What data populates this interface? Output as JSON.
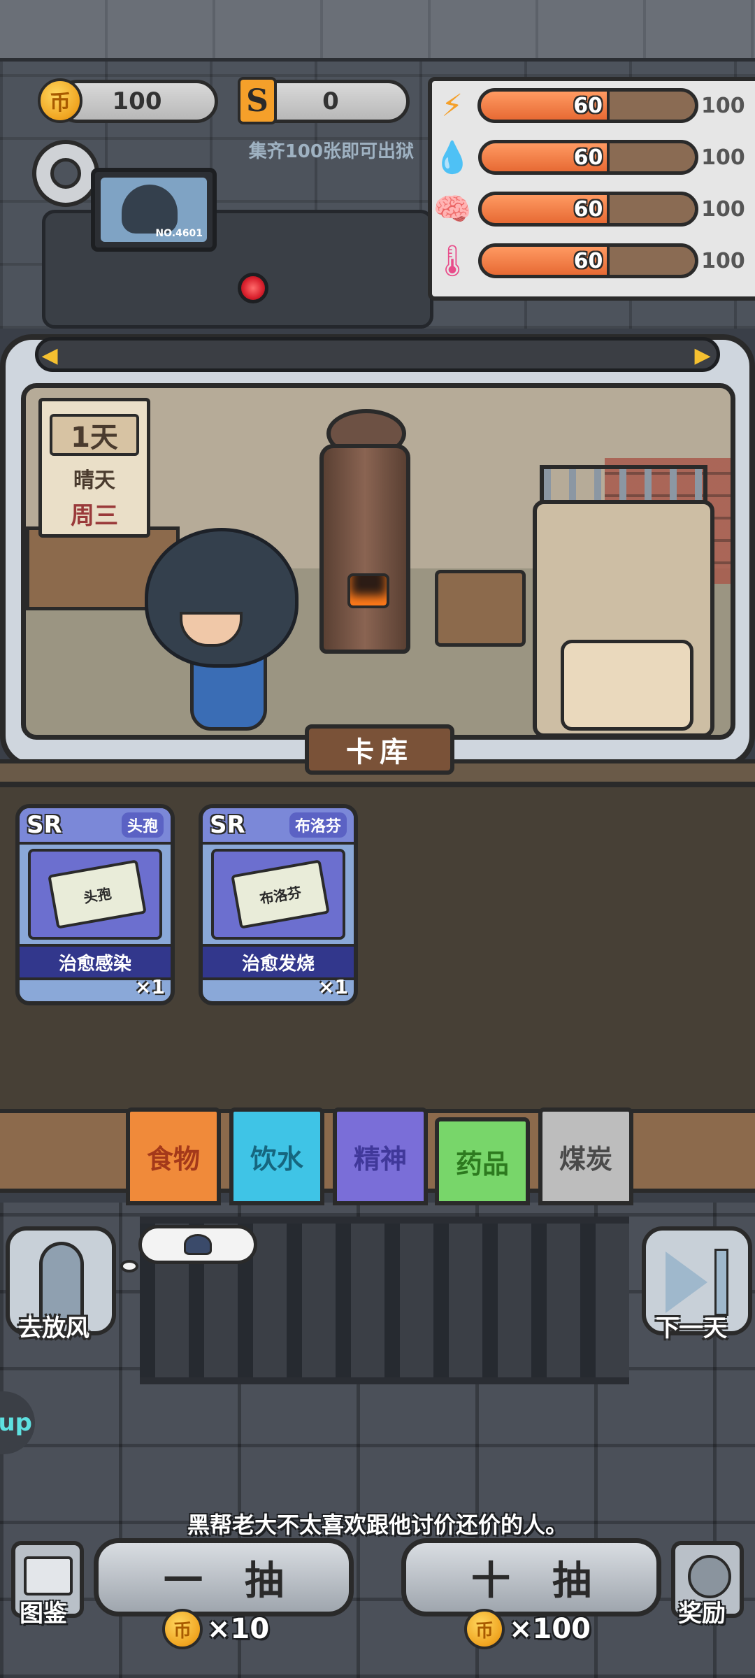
{
  "currency": {
    "coin_icon": "币",
    "coins": "100",
    "s_icon": "S",
    "shards": "0",
    "hint": "集齐100张即可出狱"
  },
  "monitor": {
    "number": "NO.4601"
  },
  "stats": [
    {
      "name": "energy",
      "icon": "lightning-icon",
      "glyph": "⚡",
      "color": "#f5a02a",
      "value": "60",
      "max": "100",
      "fill": 0.6
    },
    {
      "name": "water",
      "icon": "water-drop-icon",
      "glyph": "💧",
      "color": "#3fa8e6",
      "value": "60",
      "max": "100",
      "fill": 0.6
    },
    {
      "name": "spirit",
      "icon": "brain-icon",
      "glyph": "🧠",
      "color": "#7a6ed8",
      "value": "60",
      "max": "100",
      "fill": 0.6
    },
    {
      "name": "temperature",
      "icon": "thermometer-icon",
      "glyph": "🌡",
      "color": "#e84c8a",
      "value": "60",
      "max": "100",
      "fill": 0.6
    }
  ],
  "scene": {
    "nav_left": "◀",
    "nav_right": "▶",
    "calendar": {
      "day": "1天",
      "weather": "晴天",
      "weekday": "周三"
    }
  },
  "deck_label": "卡库",
  "cards": [
    {
      "rarity": "SR",
      "name": "头孢",
      "art_text": "头孢",
      "effect": "治愈感染",
      "count": "×1"
    },
    {
      "rarity": "SR",
      "name": "布洛芬",
      "art_text": "布洛芬",
      "effect": "治愈发烧",
      "count": "×1"
    }
  ],
  "tabs": [
    {
      "label": "食物"
    },
    {
      "label": "饮水"
    },
    {
      "label": "精神"
    },
    {
      "label": "药品"
    },
    {
      "label": "煤炭"
    }
  ],
  "side": {
    "left_label": "去放风",
    "right_label": "下一天",
    "up_tag": "up"
  },
  "message": "黑帮老大不太喜欢跟他讨价还价的人。",
  "draw": {
    "single_label": "一抽",
    "single_cost": "×10",
    "ten_label": "十抽",
    "ten_cost": "×100"
  },
  "corners": {
    "left_label": "图鉴",
    "right_label": "奖励"
  }
}
